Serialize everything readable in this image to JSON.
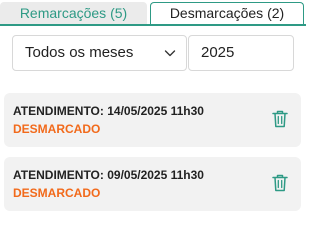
{
  "tabs": [
    {
      "label": "Remarcações (5)",
      "active": false
    },
    {
      "label": "Desmarcações (2)",
      "active": true
    }
  ],
  "filters": {
    "month_select": {
      "selected": "Todos os meses"
    },
    "year_input": {
      "value": "2025"
    }
  },
  "appointments": [
    {
      "title": "ATENDIMENTO: 14/05/2025 11h30",
      "status": "DESMARCADO"
    },
    {
      "title": "ATENDIMENTO: 09/05/2025 11h30",
      "status": "DESMARCADO"
    }
  ],
  "colors": {
    "accent": "#2e9a85",
    "status_cancelled": "#f26a1b",
    "card_background": "#f2f2f2"
  },
  "icons": {
    "select_arrow": "chevron-down-icon",
    "delete": "trash-icon"
  }
}
